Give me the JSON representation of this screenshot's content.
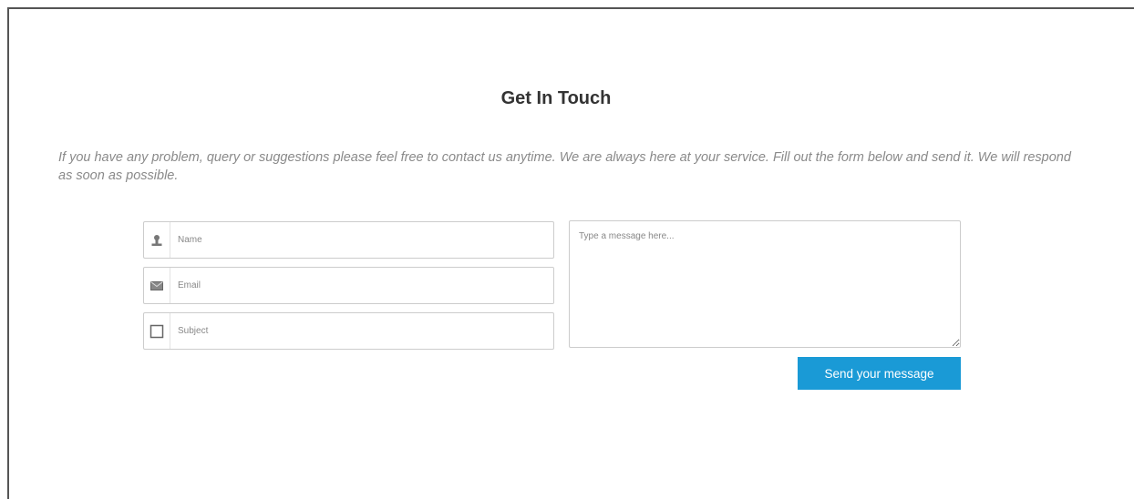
{
  "contact": {
    "title": "Get In Touch",
    "intro": "If you have any problem, query or suggestions please feel free to contact us anytime. We are always here at your service. Fill out the form below and send it. We will respond as soon as possible.",
    "fields": {
      "name": {
        "placeholder": "Name",
        "value": "",
        "icon": "user-icon"
      },
      "email": {
        "placeholder": "Email",
        "value": "",
        "icon": "envelope-icon"
      },
      "subject": {
        "placeholder": "Subject",
        "value": "",
        "icon": "square-icon"
      }
    },
    "message": {
      "placeholder": "Type a message here...",
      "value": ""
    },
    "send_label": "Send your message",
    "colors": {
      "button": "#1a9ad6",
      "title": "#333333",
      "intro": "#8a8a8a",
      "border": "#cccccc"
    }
  }
}
